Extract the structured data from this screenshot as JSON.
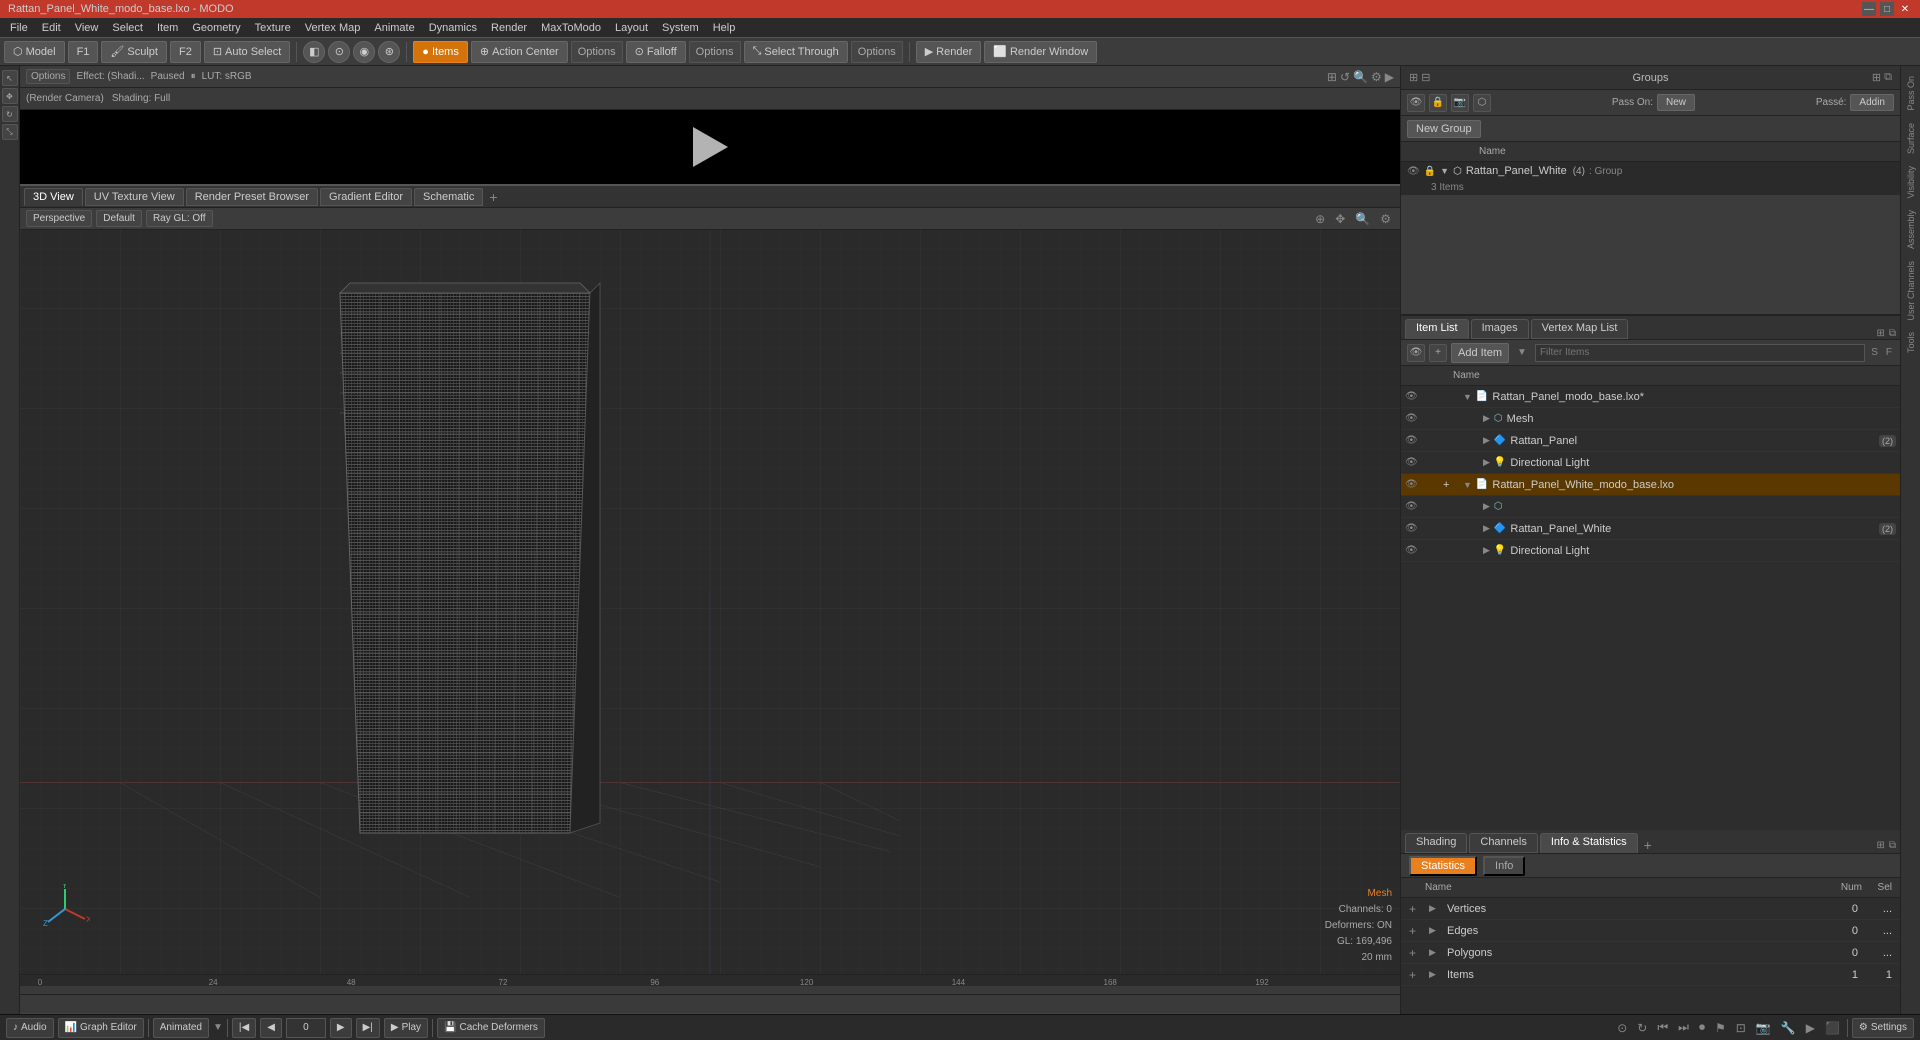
{
  "titlebar": {
    "title": "Rattan_Panel_White_modo_base.lxo - MODO",
    "controls": [
      "—",
      "□",
      "✕"
    ]
  },
  "menubar": {
    "items": [
      "File",
      "Edit",
      "View",
      "Select",
      "Item",
      "Geometry",
      "Texture",
      "Vertex Map",
      "Animate",
      "Dynamics",
      "Render",
      "MaxToModo",
      "Layout",
      "System",
      "Help"
    ]
  },
  "toolbar": {
    "model_btn": "Model",
    "f1_btn": "F1",
    "sculpt_btn": "Sculpt",
    "f2_btn": "F2",
    "auto_select_btn": "Auto Select",
    "items_btn": "Items",
    "action_center_btn": "Action Center",
    "options_btn1": "Options",
    "falloff_btn": "Falloff",
    "options_btn2": "Options",
    "select_through_btn": "Select Through",
    "options_btn3": "Options",
    "render_btn": "Render",
    "render_window_btn": "Render Window"
  },
  "preview": {
    "effects_label": "Options  Effect: (Shadi...  Paused",
    "lut_label": "LUT: sRGB",
    "camera_label": "(Render Camera)",
    "shading_label": "Shading: Full"
  },
  "viewport": {
    "tab_3d": "3D View",
    "tab_uv": "UV Texture View",
    "tab_render": "Render Preset Browser",
    "tab_gradient": "Gradient Editor",
    "tab_schematic": "Schematic",
    "perspective_label": "Perspective",
    "default_label": "Default",
    "ray_gl_label": "Ray GL: Off",
    "mesh_label": "Mesh",
    "channels_label": "Channels: 0",
    "deformers_label": "Deformers: ON",
    "gl_label": "GL: 169,496",
    "size_label": "20 mm"
  },
  "groups": {
    "title": "Groups",
    "new_group_btn": "New Group",
    "pass_on_new": "Pass On: New",
    "pass_add": "Passé: Addin",
    "item": {
      "name": "Rattan_Panel_White",
      "badge": "(4)",
      "type": ": Group",
      "sub_label": "3 Items"
    }
  },
  "item_list": {
    "tab_item": "Item List",
    "tab_images": "Images",
    "tab_vertex": "Vertex Map List",
    "add_item_btn": "Add Item",
    "filter_placeholder": "Filter Items",
    "col_name": "Name",
    "rows": [
      {
        "level": 0,
        "expanded": true,
        "icon": "📄",
        "name": "Rattan_Panel_modo_base.lxo*",
        "badge": "",
        "type": ""
      },
      {
        "level": 1,
        "expanded": false,
        "icon": "⬡",
        "name": "Mesh",
        "badge": "",
        "type": ""
      },
      {
        "level": 1,
        "expanded": true,
        "icon": "🔷",
        "name": "Rattan_Panel",
        "badge": "(2)",
        "type": ""
      },
      {
        "level": 1,
        "expanded": false,
        "icon": "💡",
        "name": "Directional Light",
        "badge": "",
        "type": ""
      },
      {
        "level": 0,
        "expanded": true,
        "icon": "📄",
        "name": "Rattan_Panel_White_modo_base.lxo",
        "badge": "",
        "type": "",
        "selected": true
      },
      {
        "level": 1,
        "expanded": false,
        "icon": "⬡",
        "name": "",
        "badge": "",
        "type": ""
      },
      {
        "level": 1,
        "expanded": true,
        "icon": "🔷",
        "name": "Rattan_Panel_White",
        "badge": "(2)",
        "type": ""
      },
      {
        "level": 1,
        "expanded": false,
        "icon": "💡",
        "name": "Directional Light",
        "badge": "",
        "type": ""
      }
    ]
  },
  "statistics": {
    "tab_shading": "Shading",
    "tab_channels": "Channels",
    "tab_info_stats": "Info & Statistics",
    "panel_stats": "Statistics",
    "panel_info": "Info",
    "col_name": "Name",
    "col_num": "Num",
    "col_sel": "Sel",
    "rows": [
      {
        "name": "Vertices",
        "num": "0",
        "sel": "..."
      },
      {
        "name": "Edges",
        "num": "0",
        "sel": "..."
      },
      {
        "name": "Polygons",
        "num": "0",
        "sel": "..."
      },
      {
        "name": "Items",
        "num": "1",
        "sel": "1"
      }
    ]
  },
  "far_right_tabs": [
    "Pass On",
    "Surface",
    "Visibility",
    "Assembly",
    "User Channels",
    "Tools"
  ],
  "bottom_bar": {
    "audio_btn": "Audio",
    "graph_editor_btn": "Graph Editor",
    "animated_btn": "Animated",
    "frame_start": "0",
    "play_btn": "Play",
    "cache_btn": "Cache Deformers",
    "settings_btn": "Settings"
  },
  "colors": {
    "accent_orange": "#e88020",
    "active_item_blue": "#4a5a7a",
    "title_bar_red": "#c0392b",
    "selected_row": "#7a4500"
  }
}
